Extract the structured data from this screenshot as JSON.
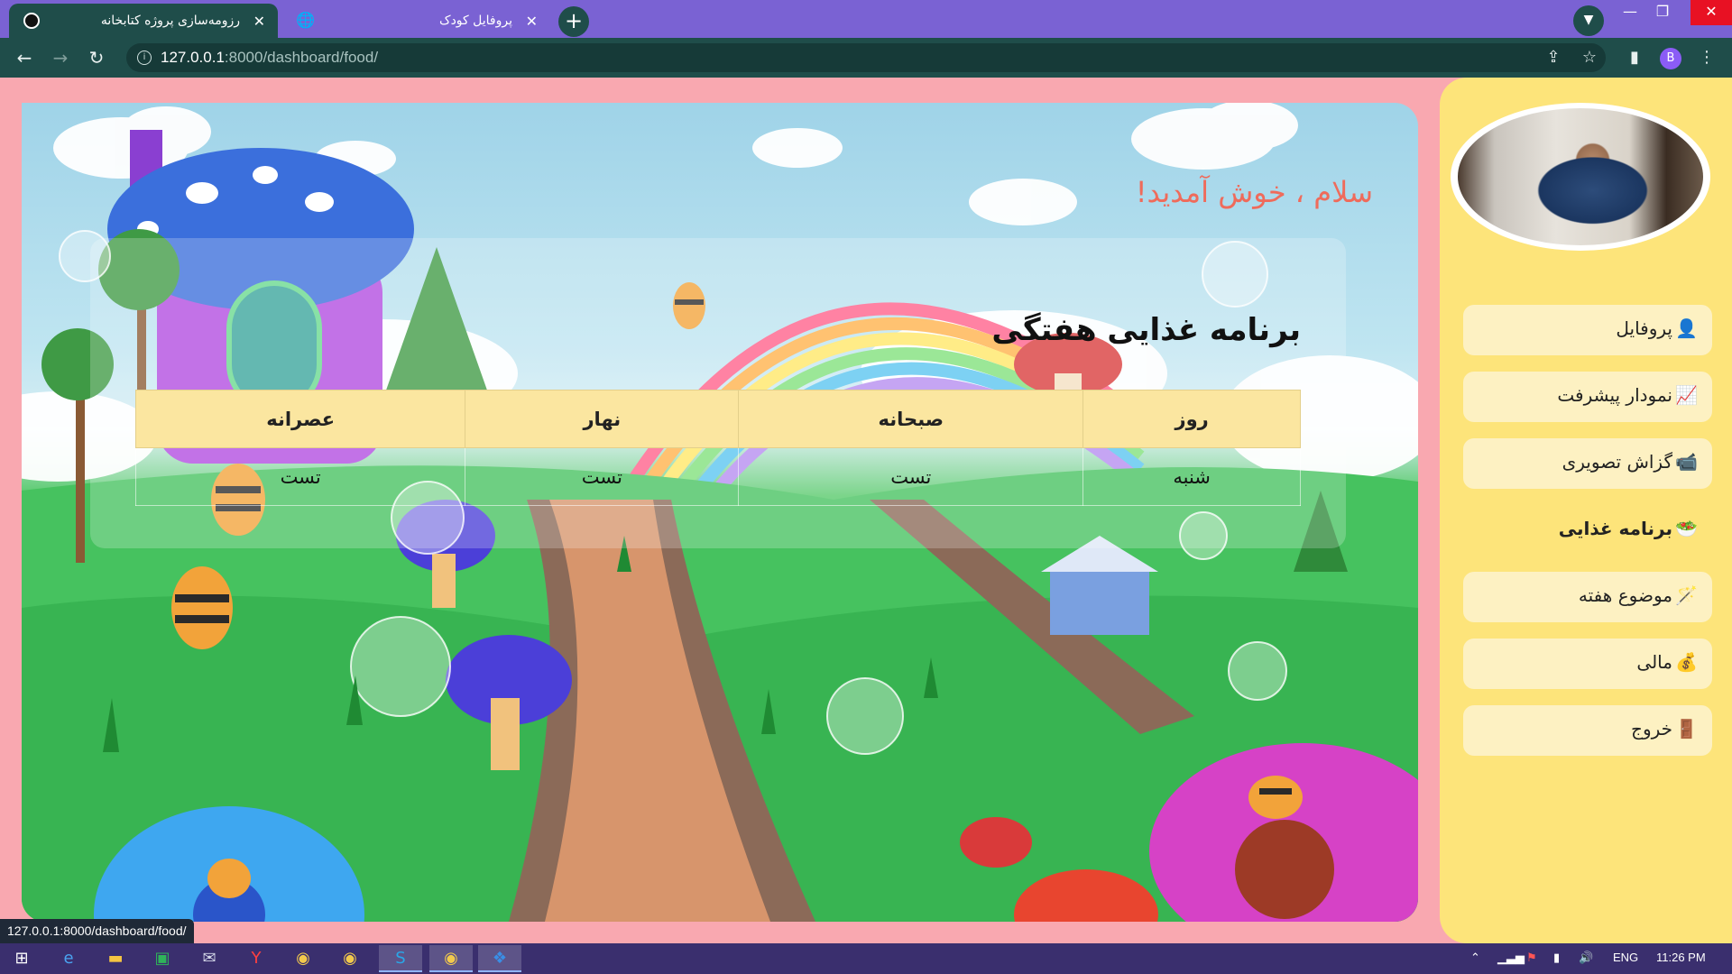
{
  "browser": {
    "tabs": [
      {
        "title": "رزومه‌سازی پروژه کتابخانه",
        "active": true
      },
      {
        "title": "پروفایل کودک",
        "active": false
      }
    ],
    "url_host": "127.0.0.1",
    "url_path": ":8000/dashboard/food/",
    "profile_initial": "B"
  },
  "main": {
    "greeting": "سلام ، خوش آمدید!",
    "table_title": "برنامه غذایی هفتگی",
    "table": {
      "headers": [
        "روز",
        "صبحانه",
        "نهار",
        "عصرانه"
      ],
      "rows": [
        [
          "شنبه",
          "تست",
          "تست",
          "تست"
        ]
      ]
    }
  },
  "sidebar": {
    "items": [
      {
        "label": "پروفایل",
        "icon": "👤",
        "active": false
      },
      {
        "label": "نمودار پیشرفت",
        "icon": "📈",
        "active": false
      },
      {
        "label": "گزاش تصویری",
        "icon": "📹",
        "active": false
      },
      {
        "label": "برنامه غذایی",
        "icon": "🥗",
        "active": true
      },
      {
        "label": "موضوع هفته",
        "icon": "🪄",
        "active": false
      },
      {
        "label": "مالی",
        "icon": "💰",
        "active": false
      },
      {
        "label": "خروج",
        "icon": "🚪",
        "active": false
      }
    ]
  },
  "status_bar": {
    "url": "127.0.0.1:8000/dashboard/food/"
  },
  "taskbar": {
    "language": "ENG",
    "time": "11:26 PM"
  },
  "colors": {
    "page_bg": "#f9a8b0",
    "sidebar_bg": "#fde47a",
    "menu_item_bg": "#fdf1c2",
    "greeting": "#ef6b5b",
    "table_header": "#fbe6a0",
    "browser_frame": "#7a62d3",
    "browser_toolbar": "#1f4d4a"
  }
}
